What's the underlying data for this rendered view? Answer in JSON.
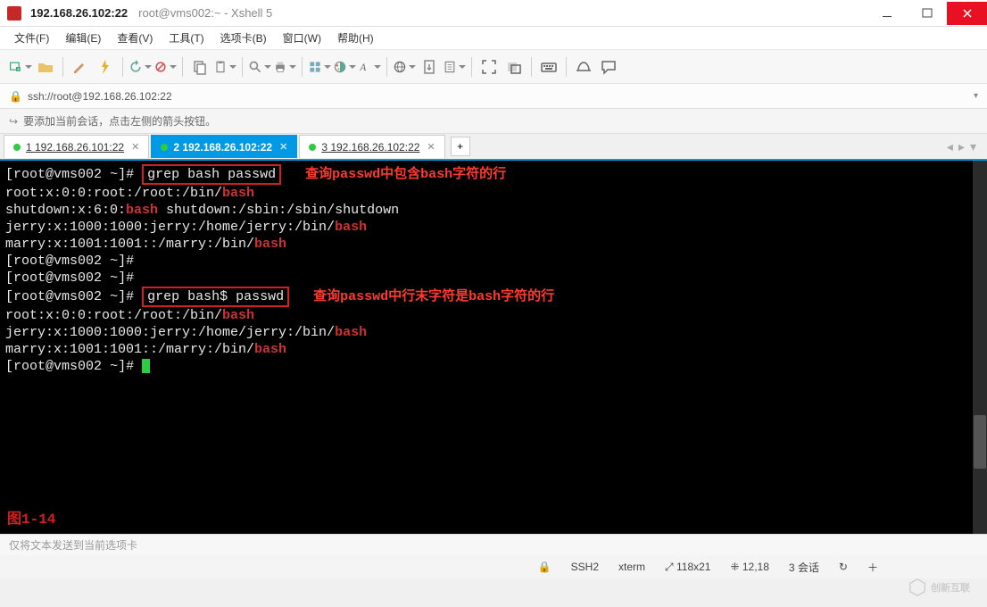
{
  "window": {
    "title_main": "192.168.26.102:22",
    "title_sub": "root@vms002:~ - Xshell 5"
  },
  "menu": {
    "file": "文件(F)",
    "edit": "编辑(E)",
    "view": "查看(V)",
    "tools": "工具(T)",
    "tabs": "选项卡(B)",
    "window": "窗口(W)",
    "help": "帮助(H)"
  },
  "address": {
    "url": "ssh://root@192.168.26.102:22"
  },
  "hint": {
    "text": "要添加当前会话，点击左侧的箭头按钮。"
  },
  "tabs": [
    {
      "label": "1 192.168.26.101:22",
      "active": false
    },
    {
      "label": "2 192.168.26.102:22",
      "active": true
    },
    {
      "label": "3 192.168.26.102:22",
      "active": false
    }
  ],
  "tab_add": "+",
  "terminal": {
    "prompt_user": "root@vms002",
    "prompt_path": "~",
    "cmd1": "grep bash passwd",
    "anno1": "查询passwd中包含bash字符的行",
    "out1_a": "root:x:0:0:root:/root:/bin/",
    "out1_a_hl": "bash",
    "out1_b_pre": "shutdown:x:6:0:",
    "out1_b_hl1": "bash",
    "out1_b_mid": " shutdown:/sbin:/sbin/shutdown",
    "out1_c": "jerry:x:1000:1000:jerry:/home/jerry:/bin/",
    "out1_c_hl": "bash",
    "out1_d": "marry:x:1001:1001::/marry:/bin/",
    "out1_d_hl": "bash",
    "cmd2": "grep bash$ passwd",
    "anno2": "查询passwd中行末字符是bash字符的行",
    "out2_a": "root:x:0:0:root:/root:/bin/",
    "out2_a_hl": "bash",
    "out2_b": "jerry:x:1000:1000:jerry:/home/jerry:/bin/",
    "out2_b_hl": "bash",
    "out2_c": "marry:x:1001:1001::/marry:/bin/",
    "out2_c_hl": "bash",
    "fig_label": "图1-14"
  },
  "input_hint": "仅将文本发送到当前选项卡",
  "status": {
    "proto": "SSH2",
    "term": "xterm",
    "size": "118x21",
    "pos": "12,18",
    "sessions": "3 会话",
    "size_icon": "⤢",
    "pos_icon": "⁜",
    "spinner": "↻",
    "plus": "＋",
    "lock": "🔒"
  },
  "watermark": "创新互联"
}
